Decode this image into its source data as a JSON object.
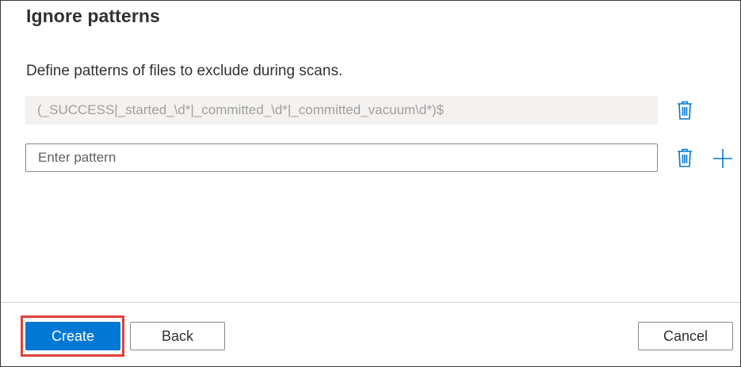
{
  "panel": {
    "title": "Ignore patterns",
    "description": "Define patterns of files to exclude during scans."
  },
  "patterns": {
    "existing_value": "(_SUCCESS|_started_\\d*|_committed_\\d*|_committed_vacuum\\d*)$",
    "new_placeholder": "Enter pattern"
  },
  "icons": {
    "delete": "trash-icon",
    "add": "plus-icon"
  },
  "footer": {
    "create_label": "Create",
    "back_label": "Back",
    "cancel_label": "Cancel"
  },
  "colors": {
    "accent": "#0078d4",
    "highlight": "#e0403a",
    "text": "#323130",
    "disabled_bg": "#f3f2f1"
  }
}
